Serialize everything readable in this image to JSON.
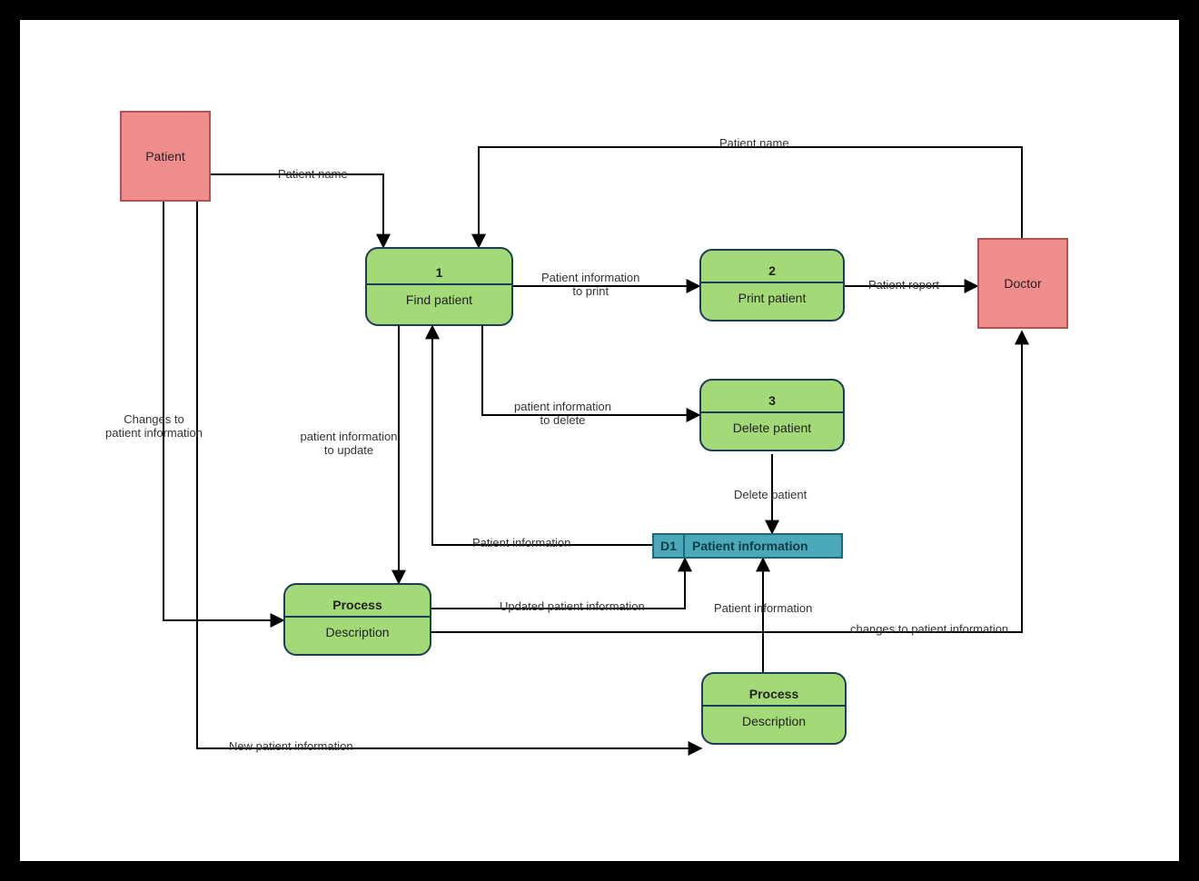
{
  "entities": {
    "patient": {
      "label": "Patient"
    },
    "doctor": {
      "label": "Doctor"
    }
  },
  "processes": {
    "find": {
      "num": "1",
      "title": "Find patient"
    },
    "print": {
      "num": "2",
      "title": "Print patient"
    },
    "delete": {
      "num": "3",
      "title": "Delete patient"
    },
    "update": {
      "num": "Process",
      "title": "Description"
    },
    "create": {
      "num": "Process",
      "title": "Description"
    }
  },
  "datastore": {
    "d1": {
      "key": "D1",
      "label": "Patient information"
    }
  },
  "flows": {
    "patientName1": "Patient name",
    "patientName2": "Patient name",
    "toPrint": "Patient information\nto print",
    "report": "Patient report",
    "toDelete": "patient information\nto delete",
    "deletePatient": "Delete patient",
    "toUpdate": "patient information\nto update",
    "patientInfo": "Patient information",
    "updatedInfo": "Updated patient information",
    "changes1": "Changes to\npatient information",
    "changes2": "changes to patient information",
    "patientInfo2": "Patient information",
    "newPatient": "New patient information"
  }
}
